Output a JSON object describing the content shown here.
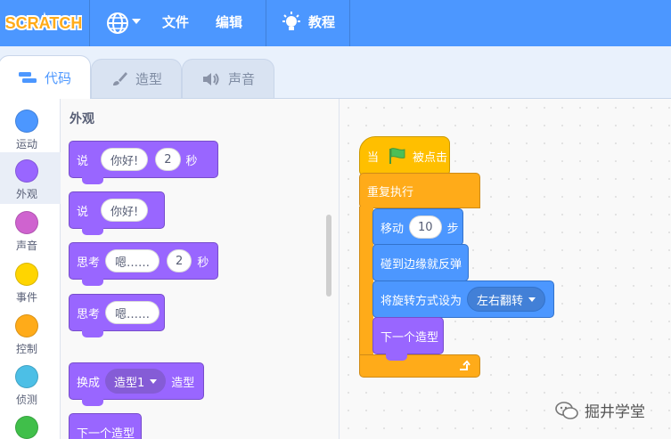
{
  "menubar": {
    "logo_text": "SCRATCH",
    "file_label": "文件",
    "edit_label": "编辑",
    "tutorials_label": "教程"
  },
  "tabs": [
    {
      "label": "代码",
      "icon": "code-icon",
      "active": true
    },
    {
      "label": "造型",
      "icon": "brush-icon",
      "active": false
    },
    {
      "label": "声音",
      "icon": "speaker-icon",
      "active": false
    }
  ],
  "categories": [
    {
      "label": "运动",
      "color": "#4c97ff"
    },
    {
      "label": "外观",
      "color": "#9966ff"
    },
    {
      "label": "声音",
      "color": "#cf63cf"
    },
    {
      "label": "事件",
      "color": "#ffd500"
    },
    {
      "label": "控制",
      "color": "#ffab19"
    },
    {
      "label": "侦测",
      "color": "#4cbfe6"
    },
    {
      "label": "",
      "color": "#40bf4a"
    }
  ],
  "palette": {
    "title": "外观",
    "blocks": {
      "say_for_secs": {
        "verb": "说",
        "text": "你好!",
        "secs": "2",
        "unit": "秒"
      },
      "say": {
        "verb": "说",
        "text": "你好!"
      },
      "think_for_secs": {
        "verb": "思考",
        "text": "嗯……",
        "secs": "2",
        "unit": "秒"
      },
      "think": {
        "verb": "思考",
        "text": "嗯……"
      },
      "switch_costume": {
        "verb": "换成",
        "costume": "造型1",
        "suffix": "造型"
      },
      "next_costume": {
        "label": "下一个造型"
      }
    }
  },
  "script": {
    "hat": {
      "prefix": "当",
      "suffix": "被点击"
    },
    "forever": {
      "label": "重复执行"
    },
    "move": {
      "verb": "移动",
      "steps": "10",
      "unit": "步"
    },
    "bounce": {
      "label": "碰到边缘就反弹"
    },
    "rotation": {
      "label": "将旋转方式设为",
      "value": "左右翻转"
    },
    "next_costume": {
      "label": "下一个造型"
    }
  },
  "watermark": {
    "text": "掘井学堂"
  },
  "colors": {
    "menubar": "#4c97ff",
    "looks": "#9966ff",
    "motion": "#4c97ff",
    "events": "#ffbf00",
    "control": "#ffab19"
  }
}
